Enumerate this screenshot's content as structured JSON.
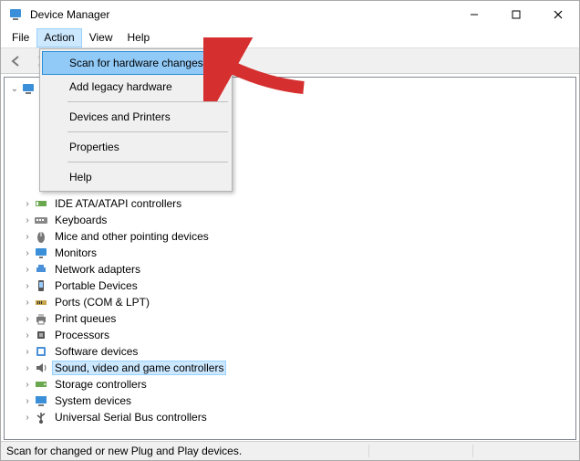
{
  "window": {
    "title": "Device Manager"
  },
  "menubar": {
    "file": "File",
    "action": "Action",
    "view": "View",
    "help": "Help"
  },
  "action_menu": {
    "scan": "Scan for hardware changes",
    "add_legacy": "Add legacy hardware",
    "devices_printers": "Devices and Printers",
    "properties": "Properties",
    "help": "Help"
  },
  "tree": {
    "root": "",
    "items": [
      "IDE ATA/ATAPI controllers",
      "Keyboards",
      "Mice and other pointing devices",
      "Monitors",
      "Network adapters",
      "Portable Devices",
      "Ports (COM & LPT)",
      "Print queues",
      "Processors",
      "Software devices",
      "Sound, video and game controllers",
      "Storage controllers",
      "System devices",
      "Universal Serial Bus controllers"
    ],
    "selected_index": 10
  },
  "statusbar": {
    "text": "Scan for changed or new Plug and Play devices."
  },
  "icons": {
    "ide": "controller",
    "keyboards": "keyboard",
    "mice": "mouse",
    "monitors": "monitor",
    "network": "network",
    "portable": "portable",
    "ports": "port",
    "printq": "printer",
    "processors": "cpu",
    "softdev": "soft",
    "sound": "speaker",
    "storage": "storage",
    "system": "system",
    "usb": "usb"
  }
}
